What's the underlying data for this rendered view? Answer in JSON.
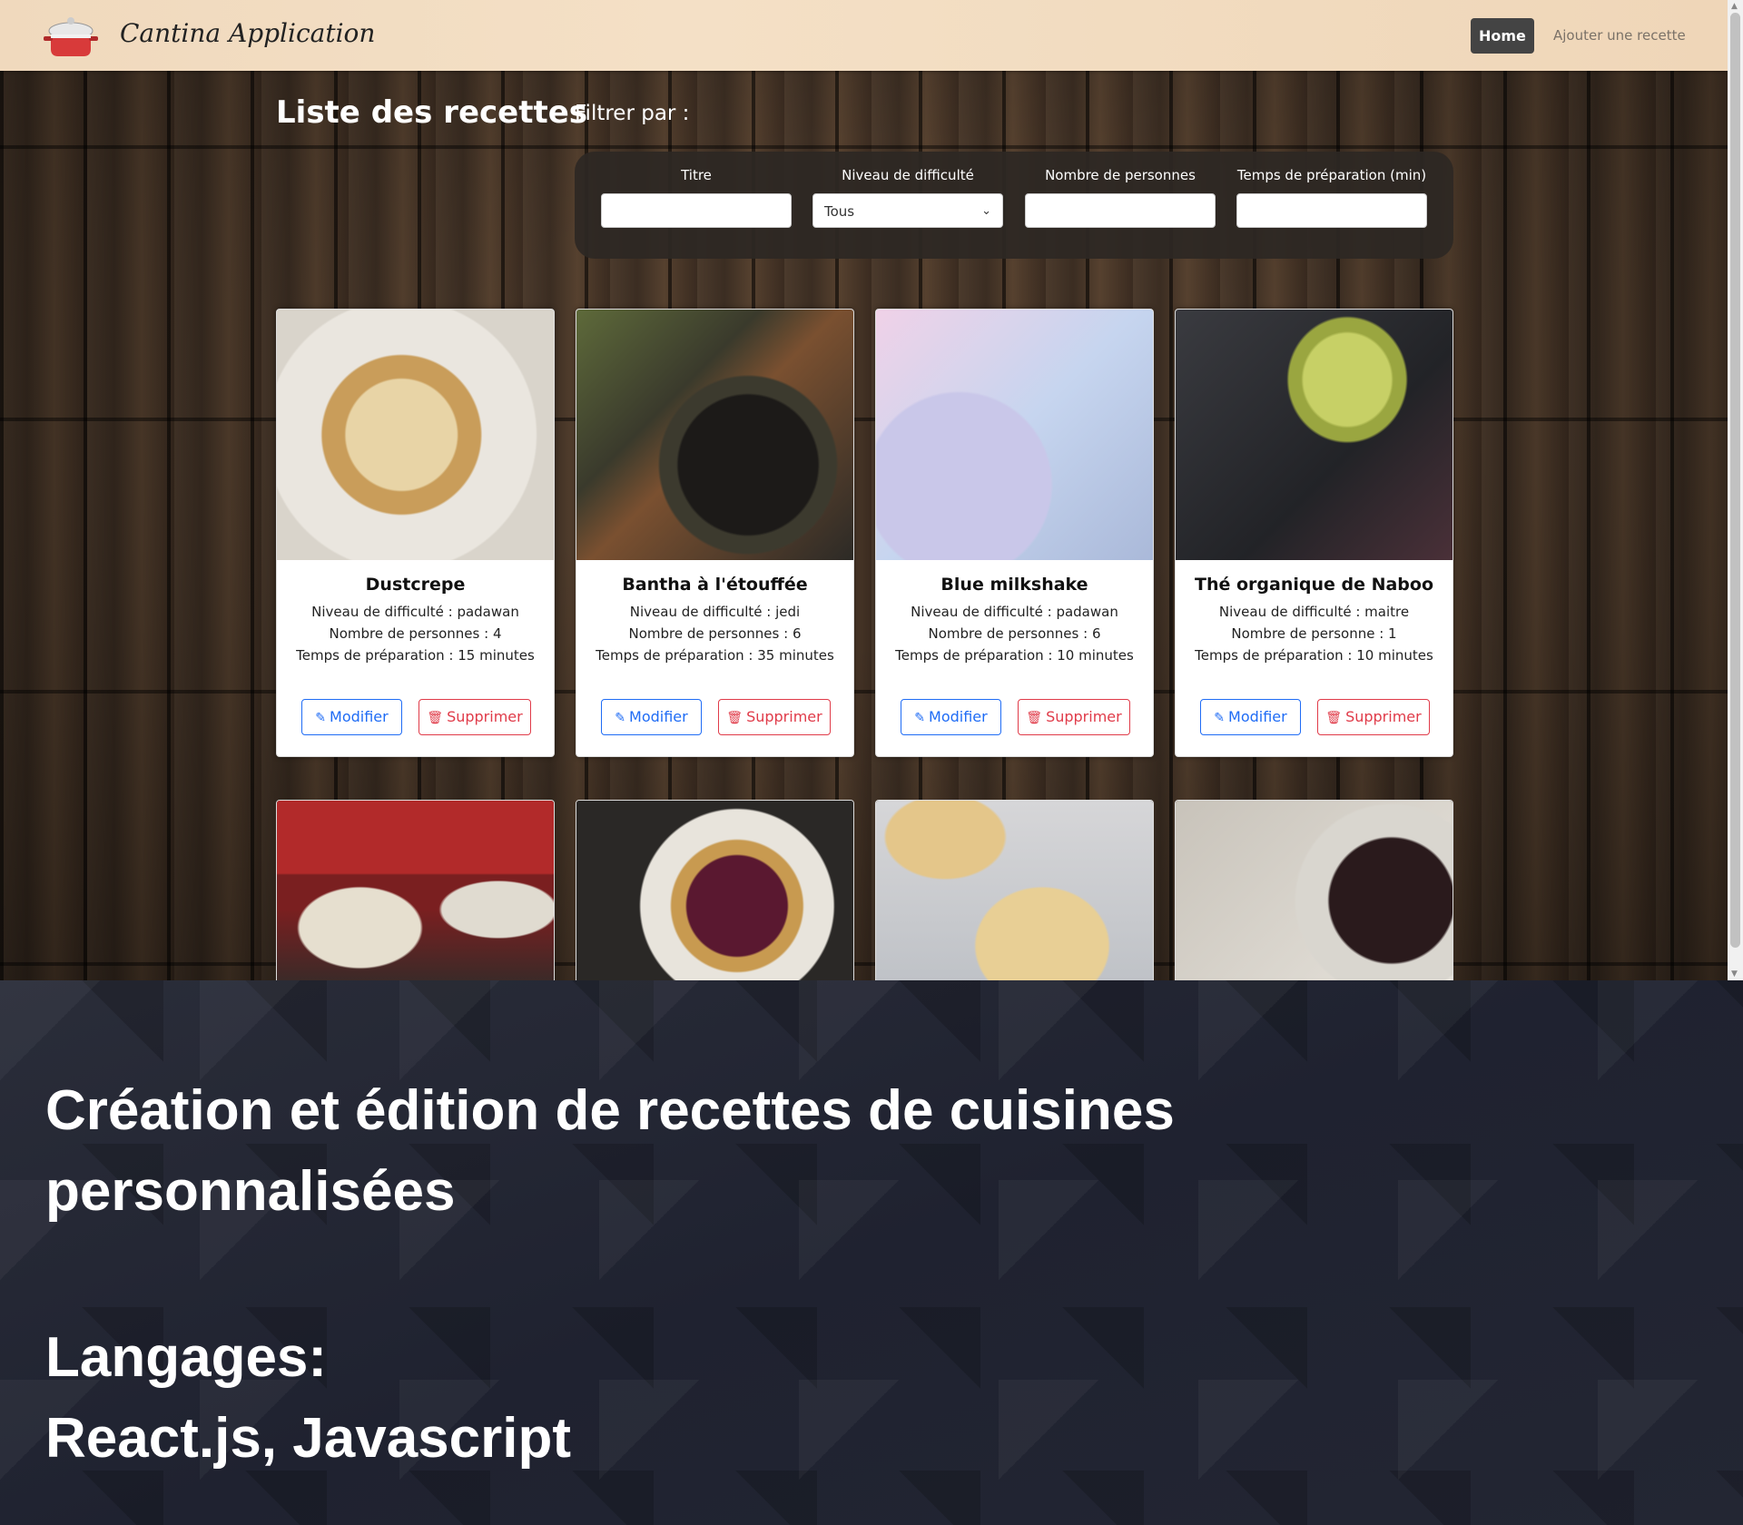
{
  "navbar": {
    "brand": "Cantina Application",
    "home_label": "Home",
    "add_label": "Ajouter une recette"
  },
  "page": {
    "title": "Liste des recettes",
    "filter_title": "Filtrer par :"
  },
  "filters": {
    "title_label": "Titre",
    "difficulty_label": "Niveau de difficulté",
    "difficulty_value": "Tous",
    "persons_label": "Nombre de personnes",
    "time_label": "Temps de préparation (min)"
  },
  "cards": [
    {
      "title": "Dustcrepe",
      "difficulty": "Niveau de difficulté : padawan",
      "persons": "Nombre de personnes : 4",
      "time": "Temps de préparation : 15 minutes",
      "edit": "Modifier",
      "delete": "Supprimer"
    },
    {
      "title": "Bantha à l'étouffée",
      "difficulty": "Niveau de difficulté : jedi",
      "persons": "Nombre de personnes : 6",
      "time": "Temps de préparation : 35 minutes",
      "edit": "Modifier",
      "delete": "Supprimer"
    },
    {
      "title": "Blue milkshake",
      "difficulty": "Niveau de difficulté : padawan",
      "persons": "Nombre de personnes : 6",
      "time": "Temps de préparation : 10 minutes",
      "edit": "Modifier",
      "delete": "Supprimer"
    },
    {
      "title": "Thé organique de Naboo",
      "difficulty": "Niveau de difficulté : maitre",
      "persons": "Nombre de personne : 1",
      "time": "Temps de préparation : 10 minutes",
      "edit": "Modifier",
      "delete": "Supprimer"
    }
  ],
  "promo": {
    "line1": "Création et édition de recettes de cuisines",
    "line2": "personnalisées",
    "line3": "Langages:",
    "line4": "React.js, Javascript"
  },
  "colors": {
    "primary": "#1f6cf5",
    "danger": "#e03b49",
    "navbar_bg": "#f0d9bd",
    "home_bg": "#444444",
    "promo_bg": "#1f2230"
  },
  "icons": {
    "logo": "cooking-pot-icon",
    "edit": "pencil-icon",
    "delete": "trash-icon",
    "select": "chevron-down-icon"
  }
}
